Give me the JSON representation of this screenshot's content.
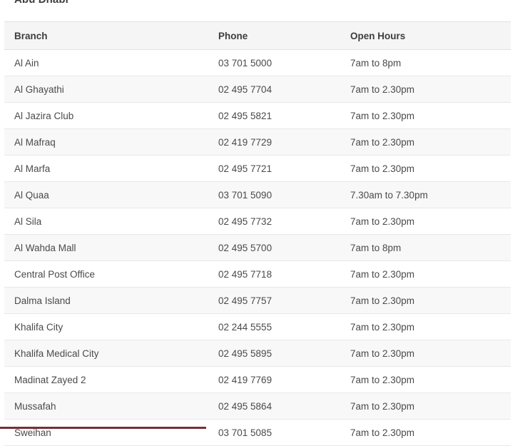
{
  "page": {
    "title": "Abu Dhabi",
    "background_color": "#ffffff"
  },
  "table": {
    "header_background": "#f5f5f5",
    "stripe_color": "#f8f8f8",
    "border_color": "#e8e8e8",
    "columns": [
      {
        "key": "branch",
        "label": "Branch"
      },
      {
        "key": "phone",
        "label": "Phone"
      },
      {
        "key": "hours",
        "label": "Open Hours"
      }
    ],
    "rows": [
      {
        "branch": "Al Ain",
        "phone": "03 701 5000",
        "hours": "7am to 8pm"
      },
      {
        "branch": "Al Ghayathi",
        "phone": "02 495 7704",
        "hours": "7am to 2.30pm"
      },
      {
        "branch": "Al Jazira Club",
        "phone": "02 495 5821",
        "hours": "7am to 2.30pm"
      },
      {
        "branch": "Al Mafraq",
        "phone": "02 419 7729",
        "hours": "7am to 2.30pm"
      },
      {
        "branch": "Al Marfa",
        "phone": "02 495 7721",
        "hours": "7am to 2.30pm"
      },
      {
        "branch": "Al Quaa",
        "phone": "03 701 5090",
        "hours": "7.30am to 7.30pm"
      },
      {
        "branch": "Al Sila",
        "phone": "02 495 7732",
        "hours": "7am to 2.30pm"
      },
      {
        "branch": "Al Wahda Mall",
        "phone": "02 495 5700",
        "hours": "7am to 8pm"
      },
      {
        "branch": "Central Post Office",
        "phone": "02 495 7718",
        "hours": "7am to 2.30pm"
      },
      {
        "branch": "Dalma Island",
        "phone": "02 495 7757",
        "hours": "7am to 2.30pm"
      },
      {
        "branch": "Khalifa City",
        "phone": "02 244 5555",
        "hours": "7am to 2.30pm"
      },
      {
        "branch": "Khalifa Medical City",
        "phone": "02 495 5895",
        "hours": "7am to 2.30pm"
      },
      {
        "branch": "Madinat Zayed 2",
        "phone": "02 419 7769",
        "hours": "7am to 2.30pm"
      },
      {
        "branch": "Mussafah",
        "phone": "02 495 5864",
        "hours": "7am to 2.30pm"
      },
      {
        "branch": "Sweihan",
        "phone": "03 701 5085",
        "hours": "7am to 2.30pm"
      }
    ]
  },
  "progress_bar": {
    "color": "#7a2f35",
    "percent": 40
  }
}
